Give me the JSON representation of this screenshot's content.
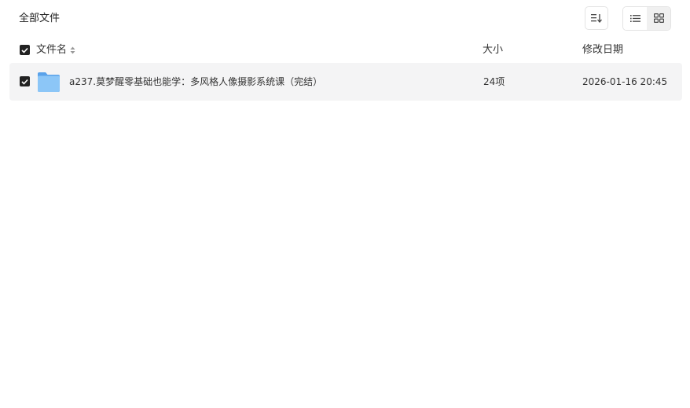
{
  "toolbar": {
    "title": "全部文件",
    "sort_icon": "sort-list-icon",
    "list_view_icon": "list-view-icon",
    "grid_view_icon": "grid-view-icon",
    "active_view": "list"
  },
  "table": {
    "select_all_checked": true,
    "columns": {
      "name": "文件名",
      "size": "大小",
      "modified": "修改日期"
    },
    "rows": [
      {
        "checked": true,
        "icon": "folder-icon",
        "name": "a237.莫梦醒零基础也能学：多风格人像摄影系统课（完结）",
        "size": "24项",
        "modified": "2026-01-16 20:45"
      }
    ]
  },
  "colors": {
    "row_highlight": "#f4f4f5",
    "checkbox": "#222222",
    "folder": "#7ab8f2"
  }
}
